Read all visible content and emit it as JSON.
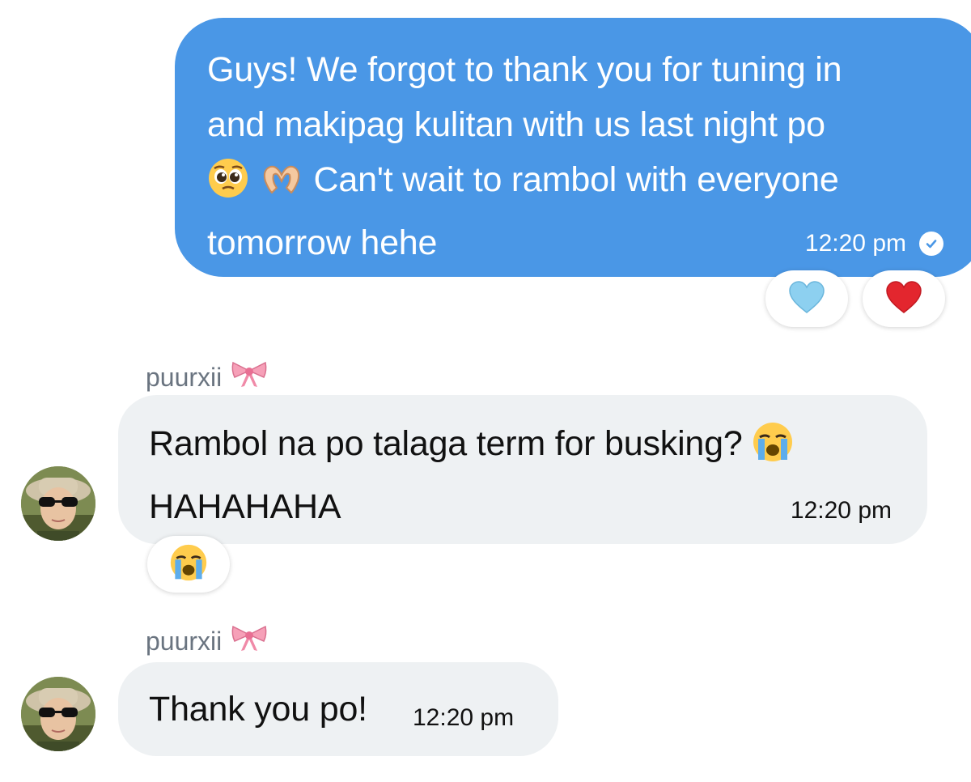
{
  "messages": [
    {
      "direction": "outgoing",
      "text_line1": "Guys! We forgot to thank you for tuning in",
      "text_line2": "and makipag kulitan with us last night po",
      "text_line3": "Can't wait to rambol with everyone",
      "text_line4": "tomorrow hehe",
      "inline_emojis": [
        "pleading-face-emoji",
        "heart-hands-emoji"
      ],
      "time": "12:20 pm",
      "status_icon": "read-check-icon",
      "reactions": [
        "light-blue-heart-emoji",
        "red-heart-emoji"
      ],
      "bubble_color": "#4a97e6"
    },
    {
      "direction": "incoming",
      "sender": "puurxii",
      "sender_emoji": "ribbon-emoji",
      "text_line1": "Rambol na po talaga term for busking?",
      "text_line2": "HAHAHAHA",
      "inline_emojis": [
        "loudly-crying-face-emoji"
      ],
      "time": "12:20 pm",
      "reactions": [
        "loudly-crying-face-emoji"
      ],
      "bubble_color": "#eef1f3"
    },
    {
      "direction": "incoming",
      "sender": "puurxii",
      "sender_emoji": "ribbon-emoji",
      "text": "Thank you po!",
      "time": "12:20 pm",
      "bubble_color": "#eef1f3"
    }
  ]
}
